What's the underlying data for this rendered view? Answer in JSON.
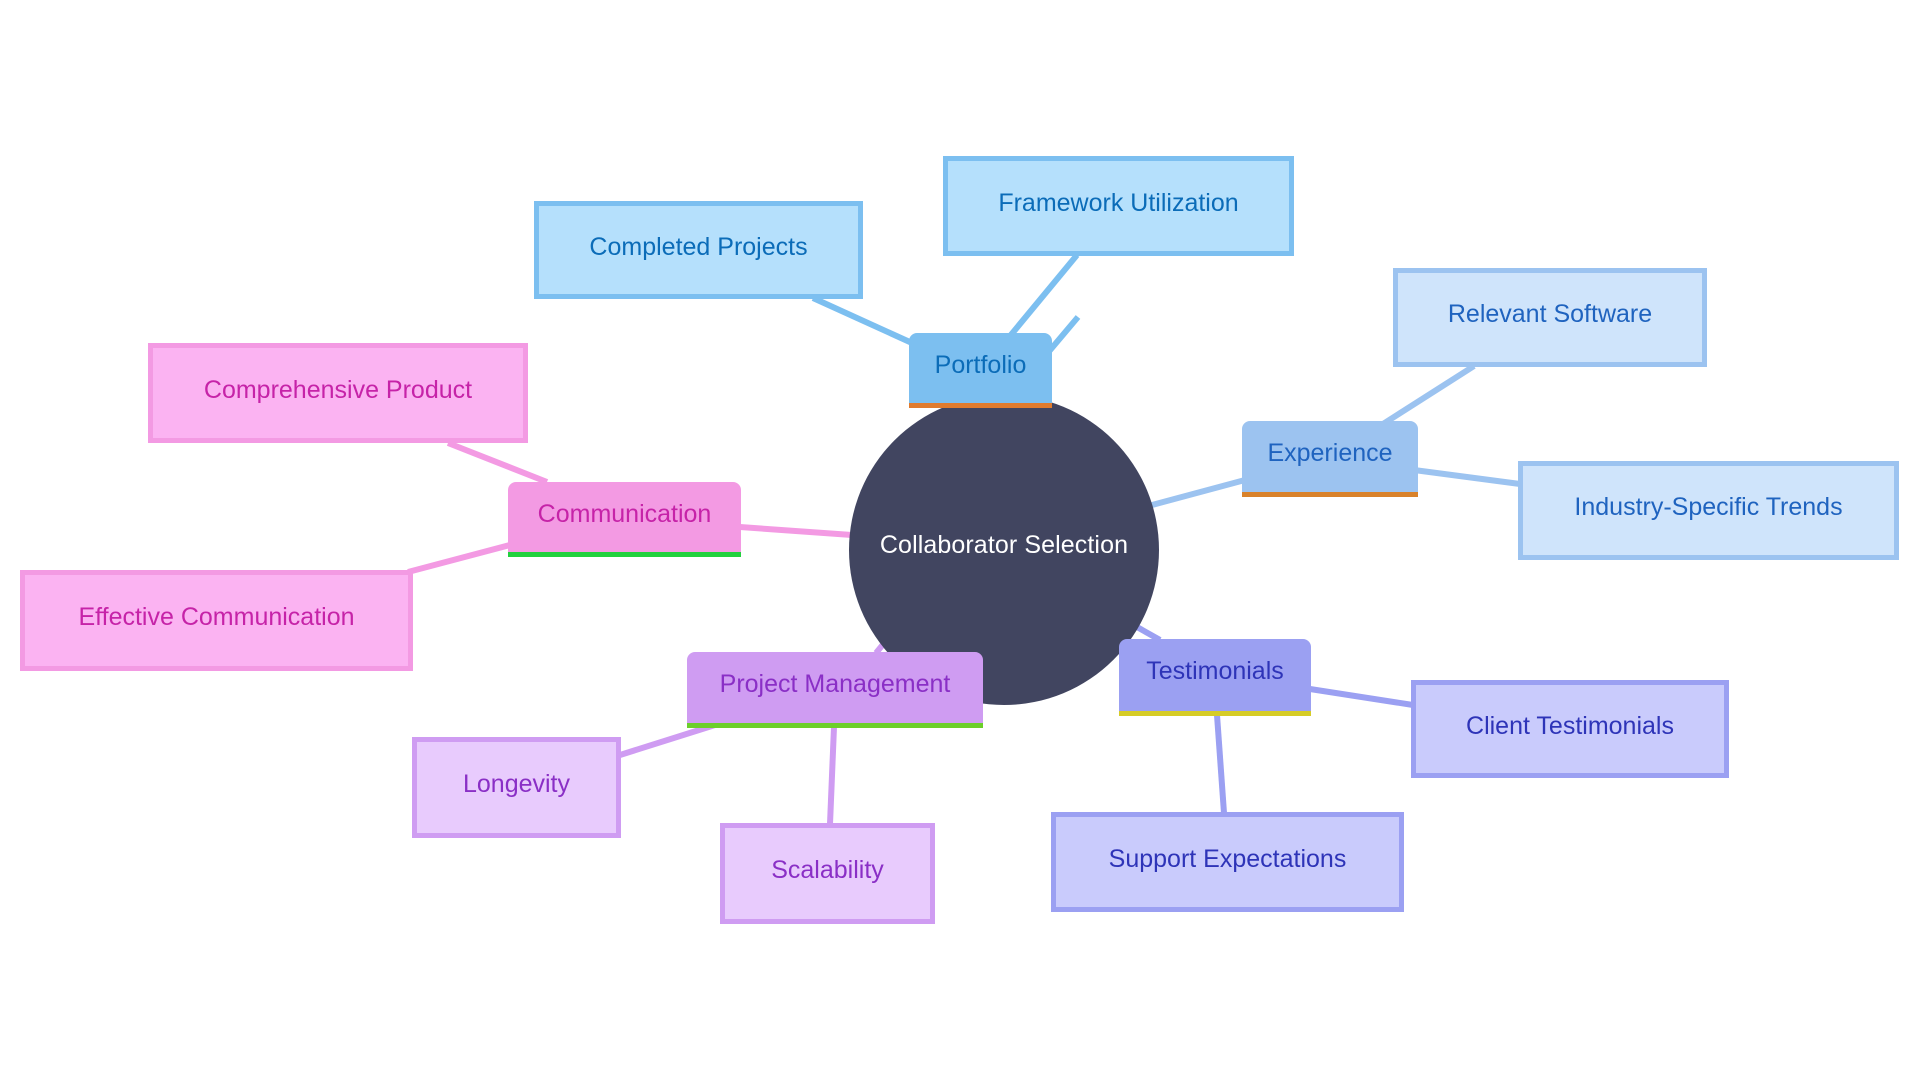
{
  "diagram": {
    "type": "mindmap",
    "root": {
      "label": "Collaborator Selection",
      "fill": "#414560",
      "text_color": "#ffffff"
    },
    "branches": [
      {
        "id": "portfolio",
        "label": "Portfolio",
        "fill": "#7cbff0",
        "text_color": "#0b6cb8",
        "bar_color": "#e07b2e",
        "edge_color": "#7cbff0",
        "leaf_fill": "#b5e0fc",
        "leaf_border": "#7cbff0",
        "children": [
          {
            "id": "completed-projects",
            "label": "Completed Projects"
          },
          {
            "id": "framework-utilization",
            "label": "Framework Utilization"
          }
        ]
      },
      {
        "id": "experience",
        "label": "Experience",
        "fill": "#9cc3f0",
        "text_color": "#1f63bf",
        "bar_color": "#d9822b",
        "edge_color": "#9cc3f0",
        "leaf_fill": "#cfe4fb",
        "leaf_border": "#9cc3f0",
        "children": [
          {
            "id": "relevant-software",
            "label": "Relevant Software"
          },
          {
            "id": "industry-specific-trends",
            "label": "Industry-Specific Trends"
          }
        ]
      },
      {
        "id": "testimonials",
        "label": "Testimonials",
        "fill": "#9ba0f2",
        "text_color": "#2e34b8",
        "bar_color": "#d6cc26",
        "edge_color": "#9ba0f2",
        "leaf_fill": "#c9cbfc",
        "leaf_border": "#9ba0f2",
        "children": [
          {
            "id": "client-testimonials",
            "label": "Client Testimonials"
          },
          {
            "id": "support-expectations",
            "label": "Support Expectations"
          }
        ]
      },
      {
        "id": "project-management",
        "label": "Project Management",
        "fill": "#cf9cf2",
        "text_color": "#8a2fc6",
        "bar_color": "#6ccf2a",
        "edge_color": "#cf9cf2",
        "leaf_fill": "#e8cbfd",
        "leaf_border": "#cf9cf2",
        "children": [
          {
            "id": "longevity",
            "label": "Longevity"
          },
          {
            "id": "scalability",
            "label": "Scalability"
          }
        ]
      },
      {
        "id": "communication",
        "label": "Communication",
        "fill": "#f39ae3",
        "text_color": "#c623a8",
        "bar_color": "#22d13e",
        "edge_color": "#f39ae3",
        "leaf_fill": "#fbb3f2",
        "leaf_border": "#f39ae3",
        "children": [
          {
            "id": "comprehensive-product",
            "label": "Comprehensive Product"
          },
          {
            "id": "effective-communication",
            "label": "Effective Communication"
          }
        ]
      }
    ]
  }
}
